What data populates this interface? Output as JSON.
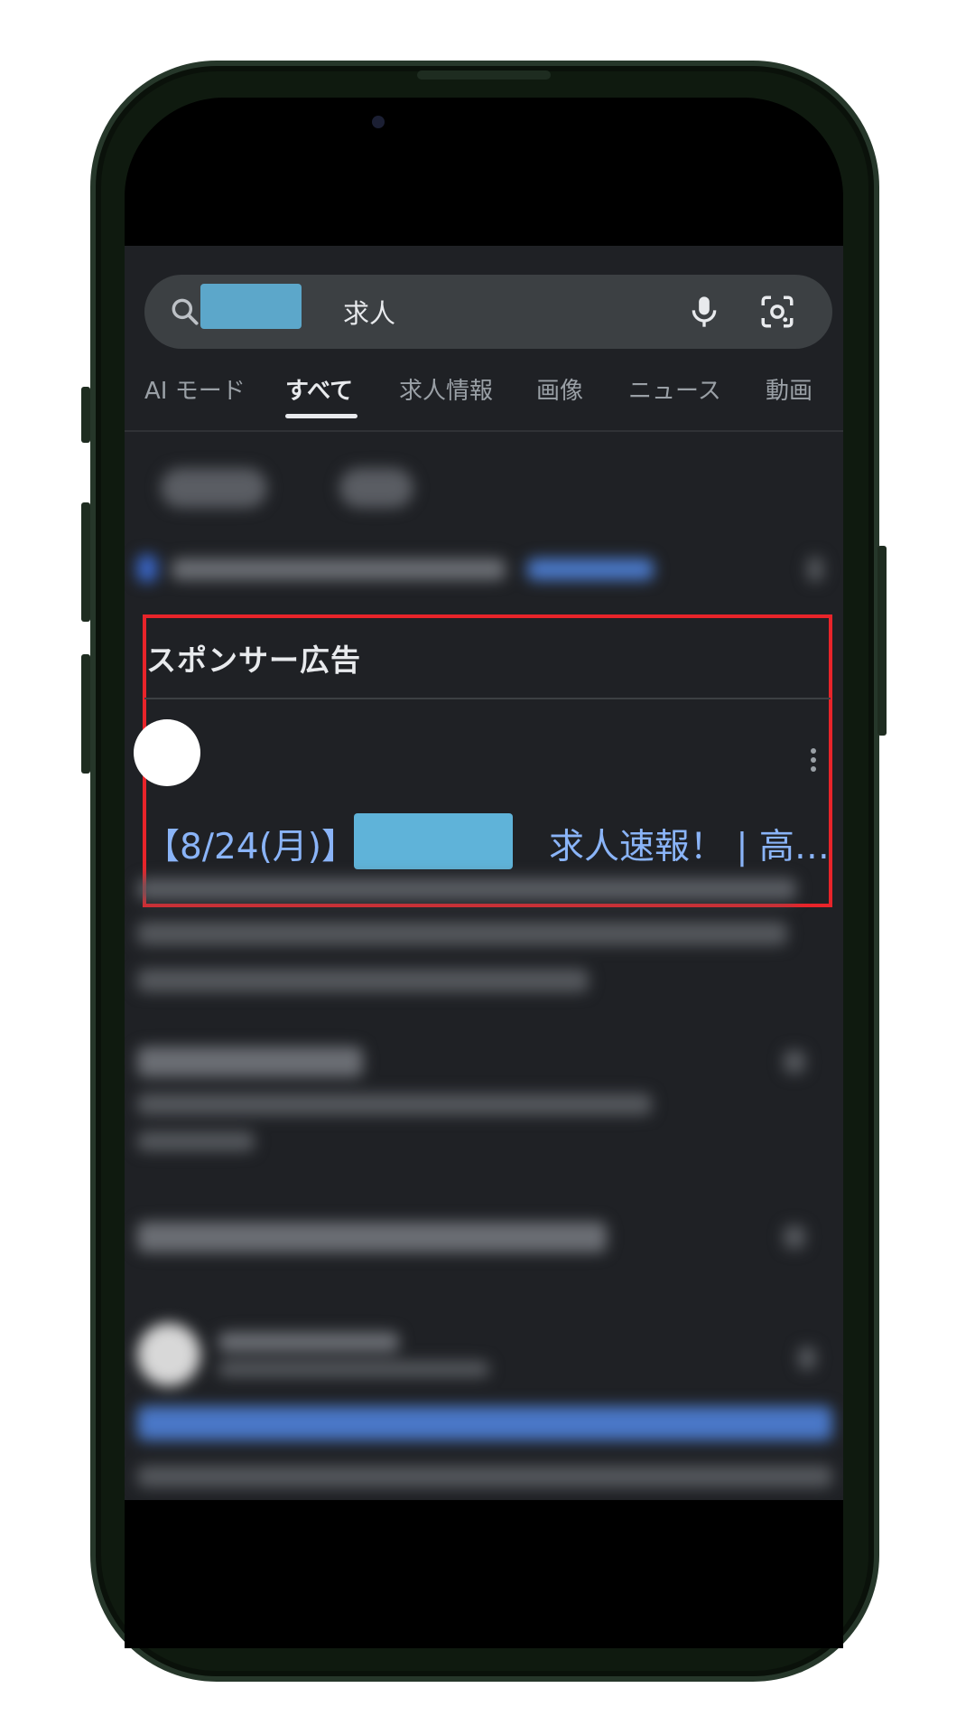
{
  "search": {
    "query_suffix": "求人"
  },
  "tabs": [
    {
      "label": "AI モード",
      "active": false
    },
    {
      "label": "すべて",
      "active": true
    },
    {
      "label": "求人情報",
      "active": false
    },
    {
      "label": "画像",
      "active": false
    },
    {
      "label": "ニュース",
      "active": false
    },
    {
      "label": "動画",
      "active": false
    }
  ],
  "sponsored": {
    "header": "スポンサー広告",
    "title_prefix": "【8/24(月)】",
    "title_suffix": "求人速報！ | 高…"
  },
  "icons": {
    "search": "search-icon",
    "mic": "mic-icon",
    "lens": "lens-icon",
    "more": "more-vert-icon"
  },
  "colors": {
    "background": "#1f2125",
    "link": "#8ab4f8",
    "highlight_border": "#e8242a",
    "redaction": "#5fb3d9"
  }
}
